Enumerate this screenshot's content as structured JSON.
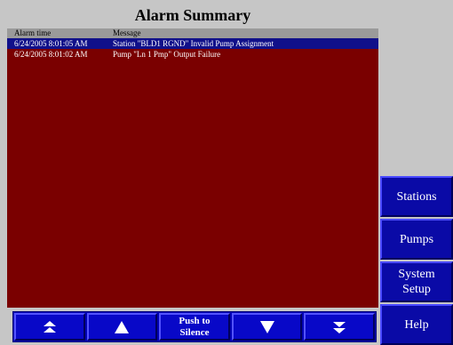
{
  "title": "Alarm Summary",
  "alarms": {
    "headers": {
      "time": "Alarm time",
      "message": "Message"
    },
    "rows": [
      {
        "time": "6/24/2005 8:01:05 AM",
        "message": "Station \"BLD1 RGND\" Invalid Pump Assignment",
        "selected": true
      },
      {
        "time": "6/24/2005 8:01:02 AM",
        "message": "Pump \"Ln 1 Pmp\" Output Failure",
        "selected": false
      }
    ]
  },
  "bottom_nav": {
    "page_up_icon": "double-up-arrow-icon",
    "up_icon": "up-arrow-icon",
    "silence_label": "Push to\nSilence",
    "down_icon": "down-arrow-icon",
    "page_down_icon": "double-down-arrow-icon"
  },
  "side_menu": {
    "stations": "Stations",
    "pumps": "Pumps",
    "system_setup": "System\nSetup",
    "help": "Help"
  },
  "colors": {
    "background": "#c6c6c6",
    "alarm_panel": "#7a0000",
    "selected_row": "#10108a",
    "button": "#0808c8"
  }
}
